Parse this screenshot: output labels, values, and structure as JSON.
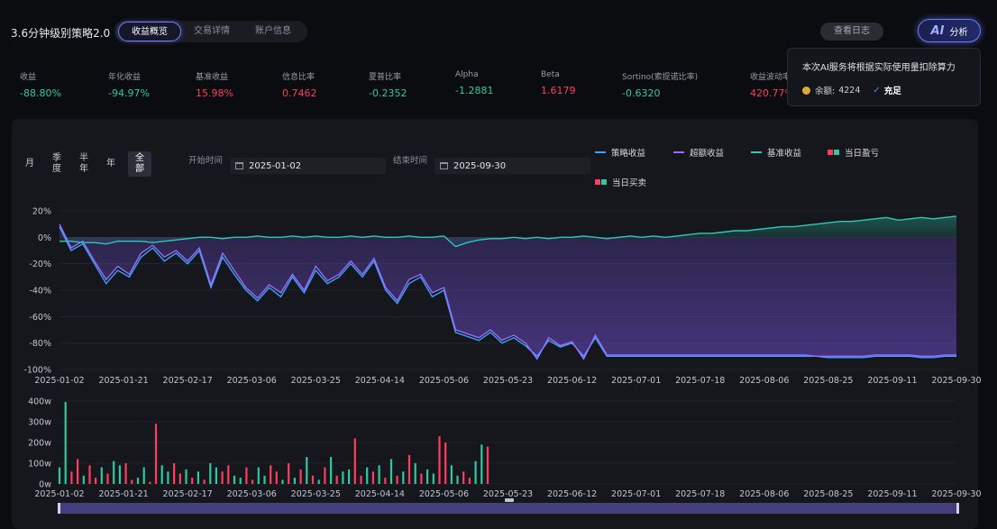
{
  "header": {
    "title": "3.6分钟级别策略2.0",
    "tabs": [
      {
        "label": "收益概览",
        "active": true
      },
      {
        "label": "交易详情",
        "active": false
      },
      {
        "label": "账户信息",
        "active": false
      }
    ],
    "log_button": "查看日志",
    "ai_button": {
      "mark": "AI",
      "label": "分析"
    }
  },
  "metrics": [
    {
      "label": "收益",
      "value": "-88.80%",
      "tone": "green"
    },
    {
      "label": "年化收益",
      "value": "-94.97%",
      "tone": "green"
    },
    {
      "label": "基准收益",
      "value": "15.98%",
      "tone": "red"
    },
    {
      "label": "信息比率",
      "value": "0.7462",
      "tone": "red"
    },
    {
      "label": "夏普比率",
      "value": "-0.2352",
      "tone": "green"
    },
    {
      "label": "Alpha",
      "value": "-1.2881",
      "tone": "green"
    },
    {
      "label": "Beta",
      "value": "1.6179",
      "tone": "red"
    },
    {
      "label": "Sortino(索提诺比率)",
      "value": "-0.6320",
      "tone": "green"
    },
    {
      "label": "收益波动率",
      "value": "420.77%",
      "tone": "red"
    }
  ],
  "popup": {
    "text": "本次AI服务将根据实际使用量扣除算力",
    "balance_label": "余额:",
    "balance_value": "4224",
    "status": "充足"
  },
  "filters": {
    "periods": [
      {
        "label": "月",
        "active": false
      },
      {
        "label": "季度",
        "active": false
      },
      {
        "label": "半年",
        "active": false
      },
      {
        "label": "年",
        "active": false
      },
      {
        "label": "全部",
        "active": true
      }
    ],
    "start_label": "开始时间",
    "start_value": "2025-01-02",
    "end_label": "结束时间",
    "end_value": "2025-09-30"
  },
  "legend": [
    {
      "label": "策略收益",
      "color": "#3aa3ff",
      "kind": "line"
    },
    {
      "label": "超额收益",
      "color": "#9b6bff",
      "kind": "line"
    },
    {
      "label": "基准收益",
      "color": "#2ec9b6",
      "kind": "line"
    },
    {
      "label": "当日盈亏",
      "color": "#ff3d5e",
      "color2": "#2ec9a0",
      "kind": "squares"
    },
    {
      "label": "当日买卖",
      "color": "#ff3d5e",
      "color2": "#2ec9a0",
      "kind": "squares"
    }
  ],
  "colors": {
    "up": "#ff3d5e",
    "down": "#2ec9a0",
    "strategy": "#3aa3ff",
    "excess": "#9b6bff",
    "benchmark": "#2ec9b6"
  },
  "chart_data": [
    {
      "type": "line",
      "x_ticks": [
        "2025-01-02",
        "2025-01-21",
        "2025-02-17",
        "2025-03-06",
        "2025-03-25",
        "2025-04-14",
        "2025-05-06",
        "2025-05-23",
        "2025-06-12",
        "2025-07-01",
        "2025-07-18",
        "2025-08-06",
        "2025-08-25",
        "2025-09-11",
        "2025-09-30"
      ],
      "y_ticks": [
        "20%",
        "0%",
        "-20%",
        "-40%",
        "-60%",
        "-80%",
        "-100%"
      ],
      "ylim": [
        -100,
        20
      ],
      "series": [
        {
          "name": "策略收益",
          "values": [
            8,
            -10,
            -5,
            -20,
            -35,
            -25,
            -30,
            -15,
            -8,
            -18,
            -12,
            -20,
            -10,
            -38,
            -15,
            -28,
            -40,
            -48,
            -38,
            -45,
            -30,
            -42,
            -25,
            -35,
            -30,
            -20,
            -30,
            -18,
            -40,
            -50,
            -35,
            -30,
            -45,
            -40,
            -72,
            -75,
            -78,
            -72,
            -80,
            -76,
            -82,
            -90,
            -78,
            -83,
            -80,
            -90,
            -76,
            -90,
            -90,
            -90,
            -90,
            -90,
            -90,
            -90,
            -90,
            -90,
            -90,
            -90,
            -90,
            -90,
            -90,
            -90,
            -90,
            -90,
            -90,
            -90,
            -91,
            -91,
            -91,
            -91,
            -90,
            -90,
            -90,
            -90,
            -91,
            -91,
            -90,
            -90
          ]
        },
        {
          "name": "超额收益",
          "values": [
            10,
            -8,
            -3,
            -18,
            -32,
            -22,
            -28,
            -12,
            -6,
            -15,
            -10,
            -18,
            -8,
            -36,
            -12,
            -25,
            -38,
            -46,
            -36,
            -42,
            -28,
            -40,
            -22,
            -33,
            -28,
            -18,
            -28,
            -16,
            -38,
            -48,
            -32,
            -28,
            -42,
            -38,
            -70,
            -73,
            -76,
            -70,
            -78,
            -74,
            -80,
            -92,
            -76,
            -82,
            -79,
            -92,
            -74,
            -89,
            -89,
            -89,
            -89,
            -89,
            -89,
            -89,
            -89,
            -89,
            -89,
            -89,
            -89,
            -89,
            -89,
            -89,
            -89,
            -89,
            -89,
            -90,
            -90,
            -90,
            -90,
            -90,
            -89,
            -89,
            -89,
            -89,
            -90,
            -90,
            -89,
            -89
          ]
        },
        {
          "name": "基准收益",
          "values": [
            -3,
            -3,
            -4,
            -4,
            -5,
            -3,
            -3,
            -3,
            -4,
            -3,
            -2,
            -1,
            0,
            0,
            -1,
            0,
            0,
            1,
            0,
            0,
            1,
            0,
            1,
            0,
            0,
            1,
            0,
            1,
            0,
            0,
            1,
            0,
            0,
            1,
            -7,
            -4,
            -2,
            -1,
            -1,
            0,
            -1,
            0,
            -1,
            0,
            0,
            1,
            0,
            -1,
            0,
            1,
            0,
            1,
            0,
            1,
            2,
            3,
            3,
            4,
            5,
            5,
            6,
            7,
            8,
            8,
            9,
            10,
            11,
            12,
            12,
            13,
            14,
            15,
            13,
            14,
            15,
            14,
            15,
            16
          ]
        }
      ]
    },
    {
      "type": "bar",
      "y_ticks": [
        "400w",
        "300w",
        "200w",
        "100w",
        "0w"
      ],
      "ylim": [
        0,
        400
      ],
      "values": [
        80,
        395,
        60,
        120,
        40,
        90,
        30,
        80,
        50,
        110,
        90,
        100,
        20,
        30,
        80,
        10,
        290,
        90,
        60,
        100,
        50,
        70,
        30,
        60,
        20,
        100,
        80,
        60,
        90,
        40,
        30,
        80,
        20,
        80,
        40,
        90,
        60,
        20,
        100,
        30,
        70,
        130,
        40,
        20,
        80,
        130,
        40,
        60,
        70,
        220,
        40,
        80,
        60,
        90,
        30,
        120,
        40,
        60,
        140,
        100,
        50,
        70,
        50,
        230,
        200,
        90,
        40,
        60,
        30,
        110,
        190,
        180
      ],
      "signs": [
        "d",
        "d",
        "u",
        "u",
        "d",
        "u",
        "u",
        "d",
        "u",
        "d",
        "d",
        "u",
        "u",
        "d",
        "d",
        "u",
        "u",
        "d",
        "d",
        "u",
        "u",
        "d",
        "u",
        "d",
        "u",
        "d",
        "d",
        "u",
        "u",
        "d",
        "d",
        "u",
        "u",
        "d",
        "d",
        "u",
        "u",
        "d",
        "u",
        "d",
        "u",
        "d",
        "u",
        "d",
        "u",
        "d",
        "u",
        "d",
        "d",
        "u",
        "u",
        "d",
        "u",
        "d",
        "u",
        "d",
        "u",
        "d",
        "u",
        "d",
        "u",
        "d",
        "d",
        "u",
        "u",
        "d",
        "d",
        "u",
        "u",
        "d",
        "d",
        "u"
      ]
    }
  ]
}
